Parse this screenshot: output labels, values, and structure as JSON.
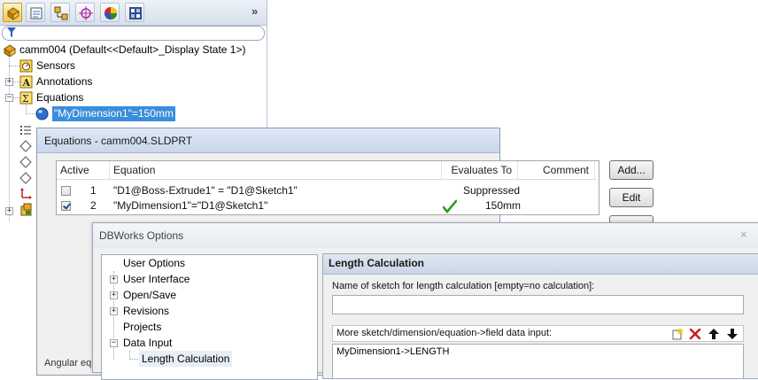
{
  "feature_tree": {
    "root_label": "camm004  (Default<<Default>_Display State 1>)",
    "items": [
      {
        "label": "Sensors"
      },
      {
        "label": "Annotations"
      },
      {
        "label": "Equations"
      },
      {
        "label": "\"MyDimension1\"=150mm"
      }
    ],
    "more_label": "»"
  },
  "equations_dialog": {
    "title": "Equations - camm004.SLDPRT",
    "columns": [
      "Active",
      "Equation",
      "Evaluates To",
      "Comment"
    ],
    "rows": [
      {
        "index": "1",
        "equation": "\"D1@Boss-Extrude1\" = \"D1@Sketch1\"",
        "evaluates": "Suppressed",
        "active": false
      },
      {
        "index": "2",
        "equation": "\"MyDimension1\"=\"D1@Sketch1\"",
        "evaluates": "150mm",
        "active": true
      }
    ],
    "add_label": "Add...",
    "edit_label": "Edit",
    "footer_fragment": "Angular eq"
  },
  "dbworks_dialog": {
    "title": "DBWorks Options",
    "close_label": "×",
    "tree": [
      {
        "label": "User Options"
      },
      {
        "label": "User Interface"
      },
      {
        "label": "Open/Save"
      },
      {
        "label": "Revisions"
      },
      {
        "label": "Projects"
      },
      {
        "label": "Data Input"
      },
      {
        "label": "Length Calculation"
      }
    ],
    "panel": {
      "header": "Length Calculation",
      "sketch_label": "Name of sketch for length calculation [empty=no calculation]:",
      "sketch_value": "",
      "more_label": "More sketch/dimension/equation->field data input:",
      "mapping_value": "MyDimension1->LENGTH"
    }
  },
  "colors": {
    "selection": "#3a8ddb",
    "check_green": "#2e9b1f"
  }
}
